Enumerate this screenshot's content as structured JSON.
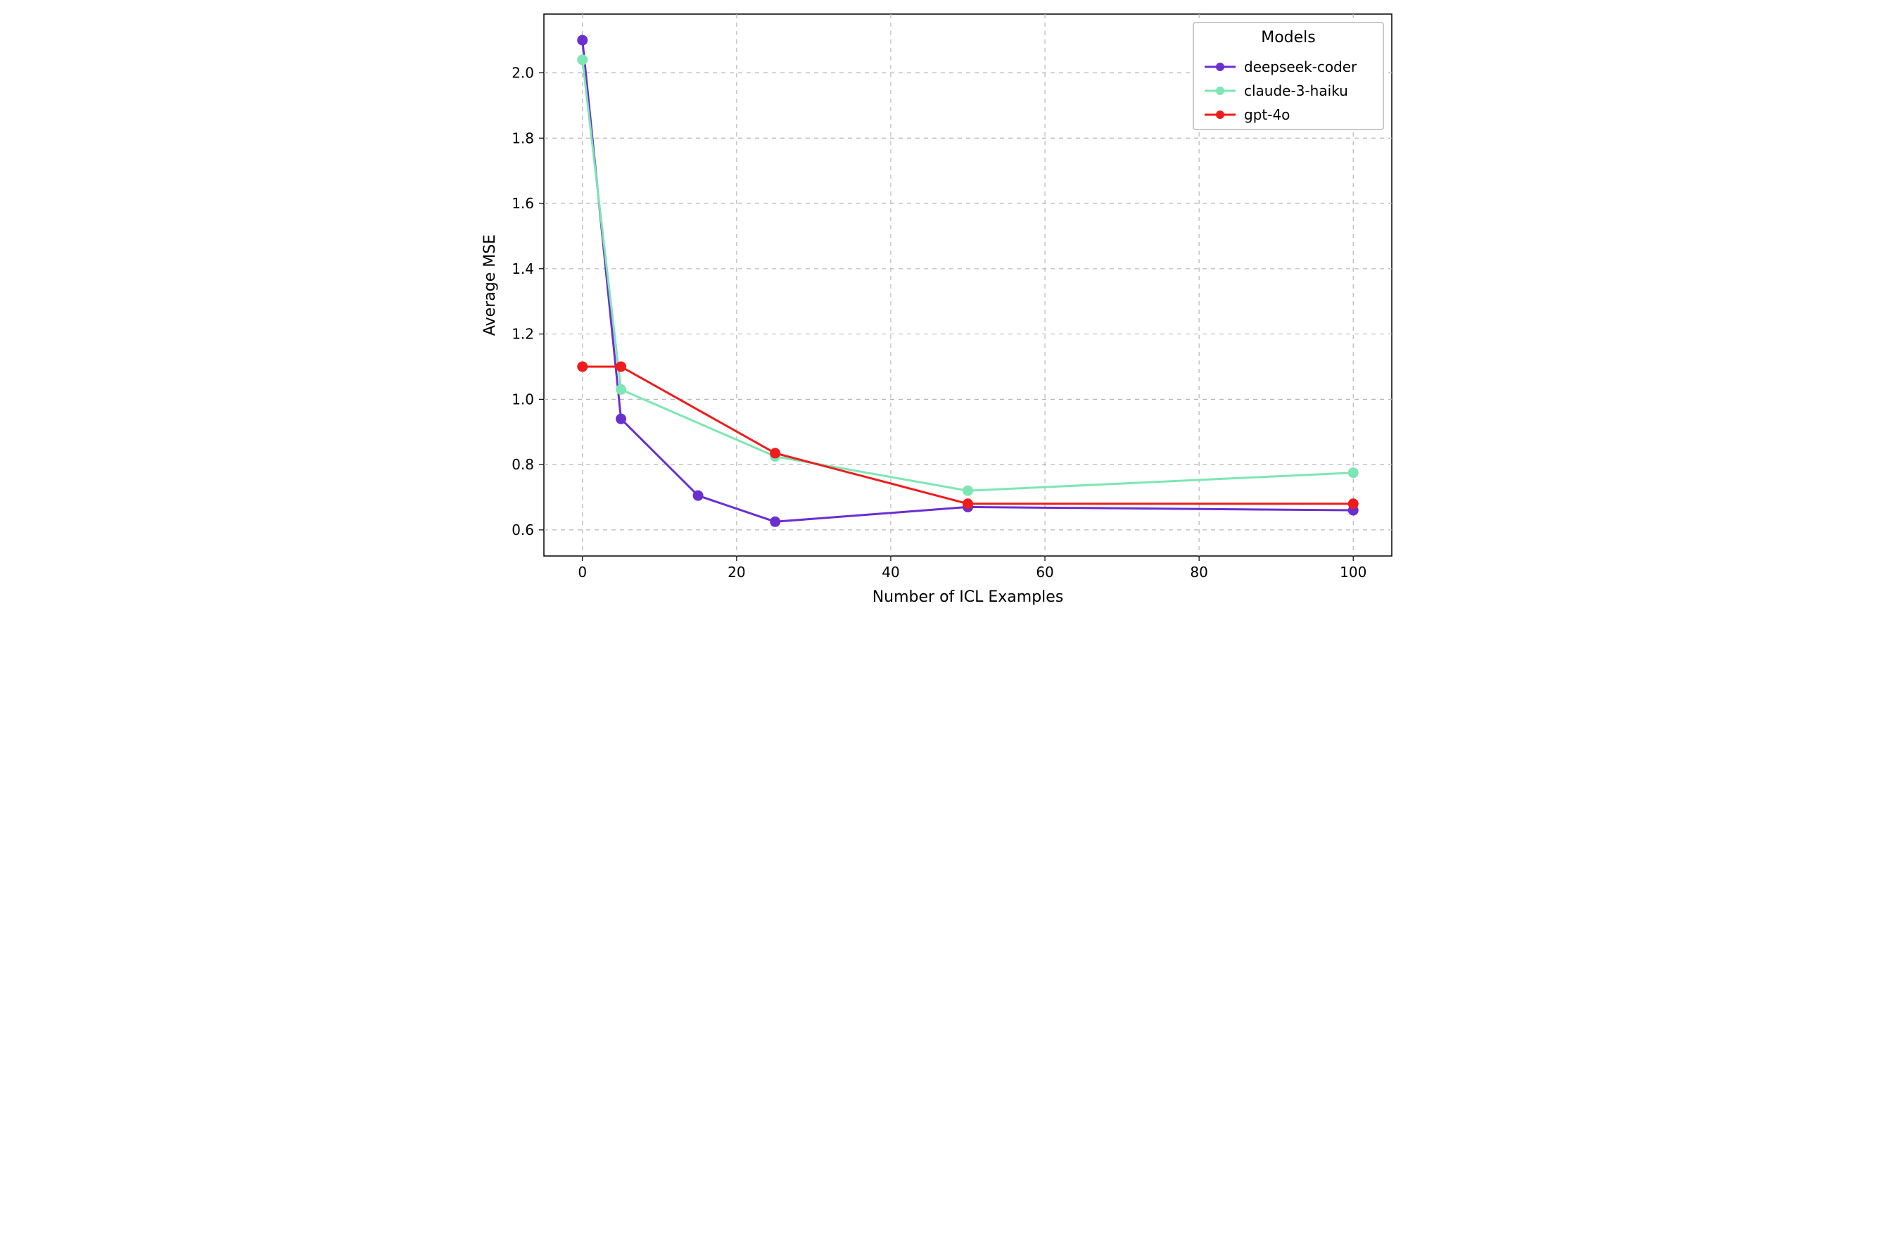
{
  "chart_data": {
    "type": "line",
    "xlabel": "Number of ICL Examples",
    "ylabel": "Average MSE",
    "title": "",
    "xlim": [
      -5,
      105
    ],
    "ylim": [
      0.52,
      2.18
    ],
    "xticks": [
      0,
      20,
      40,
      60,
      80,
      100
    ],
    "yticks": [
      0.6,
      0.8,
      1.0,
      1.2,
      1.4,
      1.6,
      1.8,
      2.0
    ],
    "legend_title": "Models",
    "legend_position": "upper right",
    "grid": true,
    "series": [
      {
        "name": "deepseek-coder",
        "color": "#6a2fd1",
        "x": [
          0,
          5,
          15,
          25,
          50,
          100
        ],
        "y": [
          2.1,
          0.94,
          0.705,
          0.625,
          0.67,
          0.66
        ]
      },
      {
        "name": "claude-3-haiku",
        "color": "#7de6b4",
        "x": [
          0,
          5,
          25,
          50,
          100
        ],
        "y": [
          2.04,
          1.03,
          0.825,
          0.72,
          0.775
        ]
      },
      {
        "name": "gpt-4o",
        "color": "#ee1c1c",
        "x": [
          0,
          5,
          25,
          50,
          100
        ],
        "y": [
          1.1,
          1.1,
          0.835,
          0.68,
          0.68
        ]
      }
    ]
  }
}
